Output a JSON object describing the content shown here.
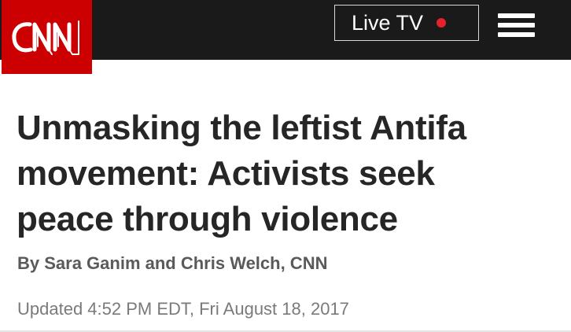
{
  "header": {
    "logo_text": "CNN",
    "live_tv_label": "Live TV",
    "live_indicator_color": "#e8202a"
  },
  "article": {
    "headline_lines": [
      "Unmasking the leftist Antifa",
      "movement: Activists seek",
      "peace through violence"
    ],
    "byline": "By Sara Ganim and Chris Welch, CNN",
    "updated": "Updated 4:52 PM EDT, Fri August 18, 2017"
  },
  "colors": {
    "brand_red": "#cc0000",
    "header_bg": "#1a1a1a"
  }
}
